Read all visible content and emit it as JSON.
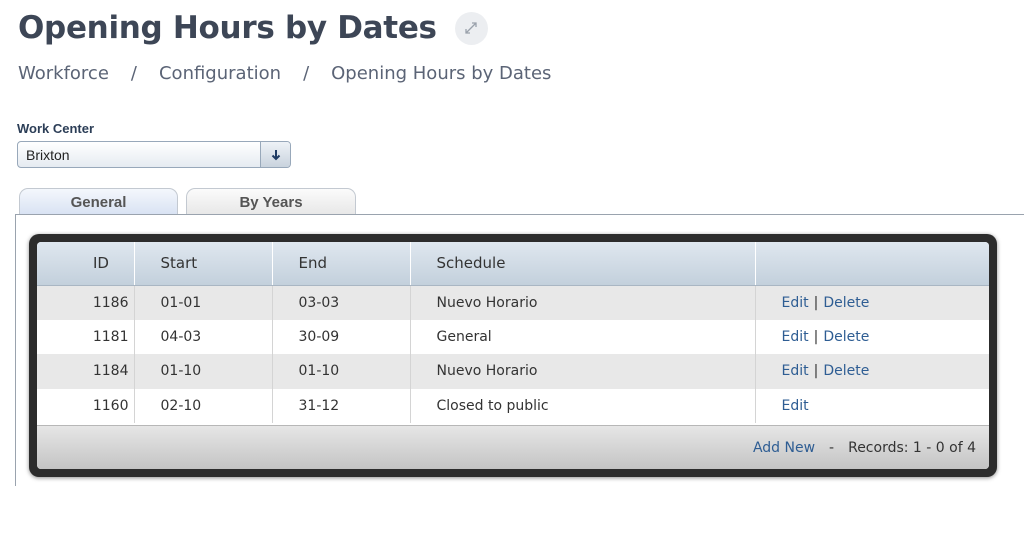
{
  "header": {
    "title": "Opening Hours by Dates",
    "expand_icon": "expand-icon"
  },
  "breadcrumb": {
    "items": [
      "Workforce",
      "Configuration",
      "Opening Hours by Dates"
    ],
    "separator": "/"
  },
  "work_center": {
    "label": "Work Center",
    "value": "Brixton"
  },
  "tabs": [
    {
      "label": "General",
      "active": true
    },
    {
      "label": "By Years",
      "active": false
    }
  ],
  "grid": {
    "columns": [
      "ID",
      "Start",
      "End",
      "Schedule",
      ""
    ],
    "rows": [
      {
        "id": "1186",
        "start": "01-01",
        "end": "03-03",
        "schedule": "Nuevo Horario",
        "edit": "Edit",
        "delete": "Delete"
      },
      {
        "id": "1181",
        "start": "04-03",
        "end": "30-09",
        "schedule": "General",
        "edit": "Edit",
        "delete": "Delete"
      },
      {
        "id": "1184",
        "start": "01-10",
        "end": "01-10",
        "schedule": "Nuevo Horario",
        "edit": "Edit",
        "delete": "Delete"
      },
      {
        "id": "1160",
        "start": "02-10",
        "end": "31-12",
        "schedule": "Closed to public",
        "edit": "Edit",
        "delete": null
      }
    ],
    "action_separator": "|",
    "footer": {
      "add_new": "Add New",
      "dash": "-",
      "records": "Records: 1 - 0 of 4"
    }
  },
  "colors": {
    "title": "#3d4656",
    "link": "#2e5d93",
    "row_alt": "#e8e8e8",
    "frame": "#2c2c2c"
  }
}
